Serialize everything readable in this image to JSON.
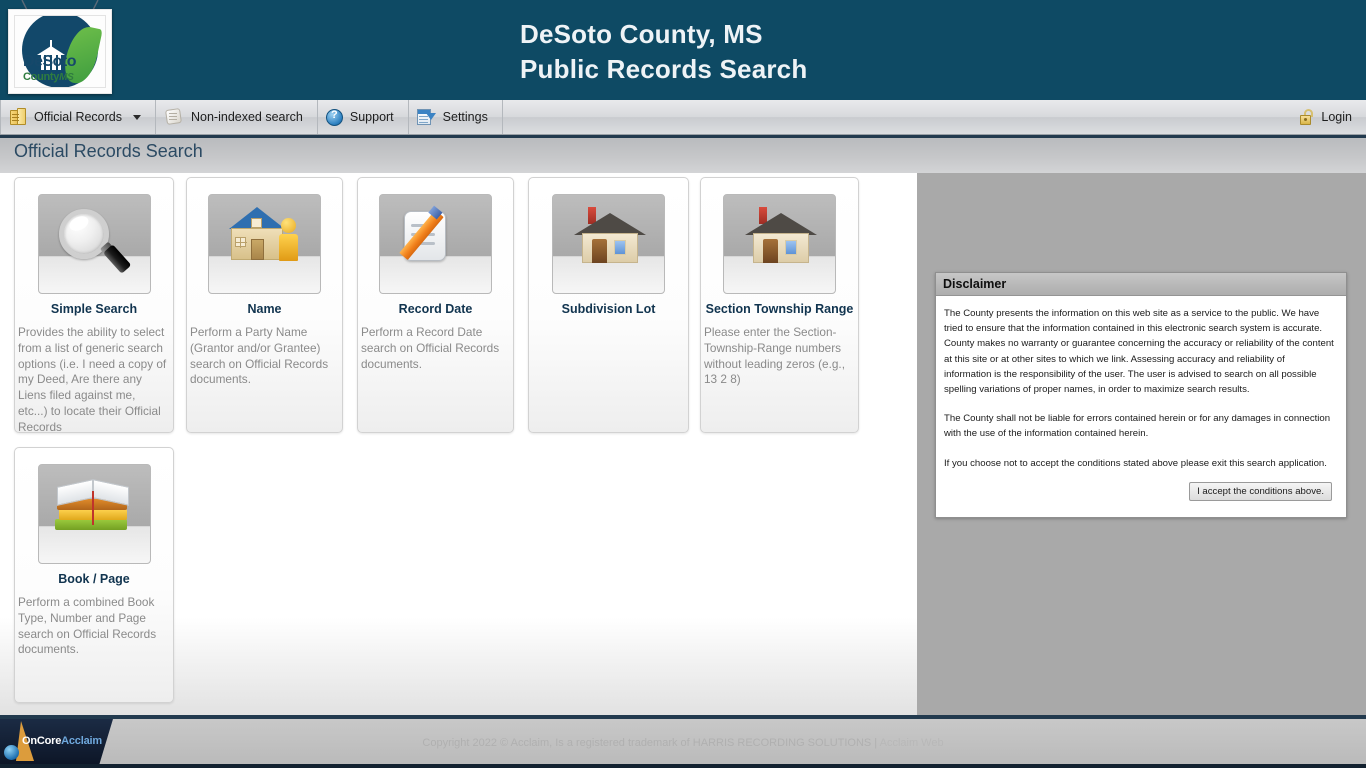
{
  "header": {
    "title": "DeSoto County, MS\nPublic Records Search",
    "logo": {
      "line1": "DeSoto",
      "line2": "County",
      "line2_italic": "MS"
    }
  },
  "nav": {
    "items": [
      {
        "label": "Official Records",
        "icon": "records-icon",
        "has_caret": true
      },
      {
        "label": "Non-indexed search",
        "icon": "scroll-icon",
        "has_caret": false
      },
      {
        "label": "Support",
        "icon": "help-icon",
        "has_caret": false
      },
      {
        "label": "Settings",
        "icon": "settings-icon",
        "has_caret": false
      }
    ],
    "login": {
      "label": "Login",
      "icon": "lock-icon"
    }
  },
  "page": {
    "title": "Official Records Search"
  },
  "cards": [
    {
      "title": "Simple Search",
      "icon": "magnifier-icon",
      "desc": "Provides the ability to select from a list of generic search options (i.e. I need a copy of my Deed, Are there any Liens filed against me, etc...) to locate their Official Records"
    },
    {
      "title": "Name",
      "icon": "house-person-icon",
      "desc": "Perform a Party Name (Grantor and/or Grantee) search on Official Records documents."
    },
    {
      "title": "Record Date",
      "icon": "document-pencil-icon",
      "desc": "Perform a Record Date search on Official Records documents."
    },
    {
      "title": "Subdivision Lot",
      "icon": "house-icon",
      "desc": ""
    },
    {
      "title": "Section Township Range",
      "icon": "house-icon",
      "desc": "Please enter the Section-Township-Range numbers without leading zeros (e.g., 13 2 8)"
    },
    {
      "title": "Book / Page",
      "icon": "books-icon",
      "desc": "Perform a combined Book Type, Number and Page search on Official Records documents."
    }
  ],
  "disclaimer": {
    "heading": "Disclaimer",
    "paragraphs": [
      "The County presents the information on this web site as a service to the public. We have tried to ensure that the information contained in this electronic search system is accurate. County makes no warranty or guarantee concerning the accuracy or reliability of the content at this site or at other sites to which we link. Assessing accuracy and reliability of information is the responsibility of the user. The user is advised to search on all possible spelling variations of proper names, in order to maximize search results.",
      "The County shall not be liable for errors contained herein or for any damages in connection with the use of the information contained herein.",
      "If you choose not to accept the conditions stated above please exit this search application."
    ],
    "accept_button": "I accept the conditions above."
  },
  "footer": {
    "brand_primary": "OnCore",
    "brand_secondary": "Acclaim",
    "copyright": "Copyright 2022 © Acclaim, Is a registered trademark of HARRIS RECORDING SOLUTIONS | ",
    "link": "Acclaim Web"
  },
  "colors": {
    "header_bg": "#0e4a64",
    "accent_navy": "#223a4e",
    "card_title": "#11344f",
    "page_title": "#2b4a63",
    "page_bg": "#a9a9a9"
  }
}
